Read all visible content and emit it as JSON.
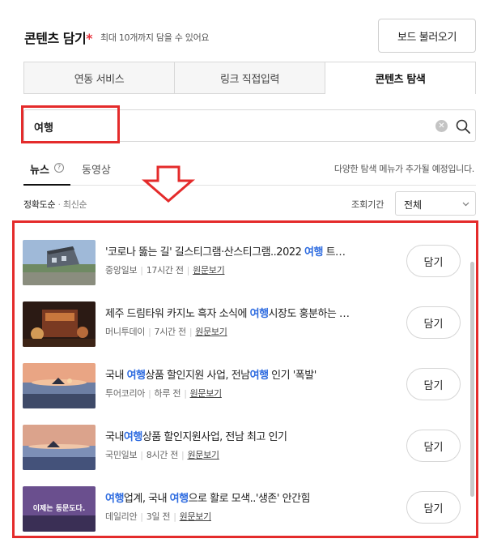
{
  "header": {
    "title": "콘텐츠 담기",
    "required_mark": "*",
    "subtitle": "최대 10개까지 담을 수 있어요",
    "load_board_label": "보드 불러오기"
  },
  "tabs": [
    {
      "label": "연동 서비스",
      "active": false
    },
    {
      "label": "링크 직접입력",
      "active": false
    },
    {
      "label": "콘텐츠 탐색",
      "active": true
    }
  ],
  "search": {
    "value": "여행",
    "clear_icon": "clear-icon",
    "search_icon": "search-icon"
  },
  "subtabs": {
    "news": "뉴스",
    "help_glyph": "?",
    "video": "동영상",
    "notice": "다양한 탐색 메뉴가 추가될 예정입니다."
  },
  "sort": {
    "accuracy": "정확도순",
    "separator": "·",
    "recent": "최신순",
    "period_label": "조회기간",
    "period_value": "전체"
  },
  "colors": {
    "highlight": "#2f6ce0",
    "annotation_red": "#e42b2b"
  },
  "results": [
    {
      "headline_parts": [
        "'코로나 뚫는 길' 길스티그램·산스티그램..2022 ",
        "여행",
        " 트…"
      ],
      "source": "중앙일보",
      "time": "17시간 전",
      "original_link": "원문보기",
      "button": "담기",
      "thumb_text": ""
    },
    {
      "headline_parts": [
        "제주 드림타워 카지노 흑자 소식에 ",
        "여행",
        "시장도 훙분하는 …"
      ],
      "source": "머니투데이",
      "time": "7시간 전",
      "original_link": "원문보기",
      "button": "담기",
      "thumb_text": ""
    },
    {
      "headline_parts": [
        "국내 ",
        "여행",
        "상품 할인지원 사업, 전남",
        "여행",
        " 인기 '폭발'"
      ],
      "source": "투어코리아",
      "time": "하루 전",
      "original_link": "원문보기",
      "button": "담기",
      "thumb_text": ""
    },
    {
      "headline_parts": [
        "국내",
        "여행",
        "상품 할인지원사업, 전남 최고 인기"
      ],
      "source": "국민일보",
      "time": "8시간 전",
      "original_link": "원문보기",
      "button": "담기",
      "thumb_text": ""
    },
    {
      "headline_parts": [
        "",
        "여행",
        "업계, 국내 ",
        "여행",
        "으로 활로 모색..'생존' 안간힘"
      ],
      "source": "데일리안",
      "time": "3일 전",
      "original_link": "원문보기",
      "button": "담기",
      "thumb_text": "이제는 동문도다."
    }
  ]
}
